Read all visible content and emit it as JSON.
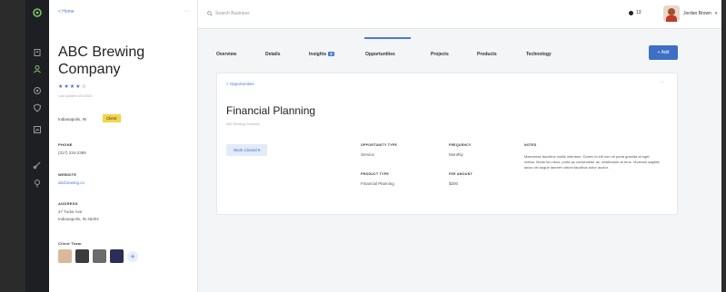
{
  "rail": {
    "icons": [
      "logo-icon",
      "building-icon",
      "people-icon",
      "target-icon",
      "shield-icon",
      "chart-icon",
      "link-icon",
      "pin-icon"
    ]
  },
  "company": {
    "back_label": "< Home",
    "name": "ABC Brewing Company",
    "stars": "★★★★☆",
    "updated": "Last Updated 4/10/2023",
    "location": "Indianapolis, IN",
    "tag": "Client",
    "phone_label": "PHONE",
    "phone": "(317) 234-2389",
    "website_label": "WEBSITE",
    "website": "abcbrewing.co",
    "address_label": "ADDRESS",
    "address_line1": "47 Tudor Ave",
    "address_line2": "Indianapolis, IN 46204",
    "team_label": "Client Team",
    "add_team": "+"
  },
  "topbar": {
    "search_placeholder": "Search Business",
    "notif_count": "13",
    "user_name": "Jordan Brown",
    "user_chevron": "▾"
  },
  "tabs": [
    {
      "label": "Overview"
    },
    {
      "label": "Details"
    },
    {
      "label": "Insights",
      "badge": "3"
    },
    {
      "label": "Opportunities",
      "active": true
    },
    {
      "label": "Projects"
    },
    {
      "label": "Products"
    },
    {
      "label": "Technology"
    }
  ],
  "add_button": "+ Add",
  "card": {
    "breadcrumb": "< Opportunities",
    "menu": "···",
    "title": "Financial Planning",
    "subtitle": "ABC Brewing Company",
    "status": "Work Closed ▾",
    "opportunity_type_label": "OPPORTUNITY TYPE",
    "opportunity_type": "Service",
    "product_type_label": "PRODUCT TYPE",
    "product_type": "Financial Planning",
    "frequency_label": "FREQUENCY",
    "frequency": "Monthly",
    "fee_label": "FEE AMOUNT",
    "fee": "$200",
    "notes_label": "NOTES",
    "notes": "Maecenas faucibus mollis interdum. Donec id elit non mi porta gravida at eget metus. Morbi leo risus, porta ac consectetur ac, vestibulum at eros. Vivamus sagittis lacus vel augue laoreet rutrum faucibus dolor auctor."
  },
  "colors": {
    "accent": "#4a7bd0",
    "tag": "#f3d54a",
    "rail": "#1e1f22"
  }
}
